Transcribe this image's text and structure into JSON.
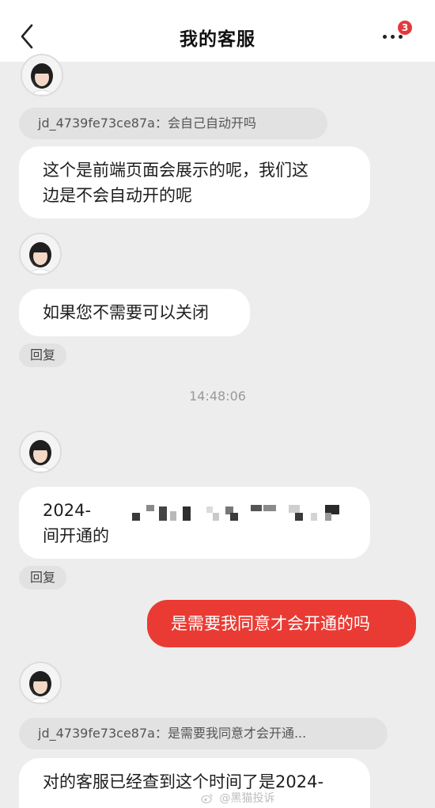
{
  "header": {
    "title": "我的客服",
    "badge_count": "3"
  },
  "messages": {
    "quote_1": "jd_4739fe73ce87a：会自己自动开吗",
    "reply_1": "这个是前端页面会展示的呢，我们这边是不会自动开的呢",
    "reply_1_line1": "这个是前端页面会展示的呢，我们这",
    "reply_1_line2": "边是不会自动开的呢",
    "reply_2": "如果您不需要可以关闭",
    "reply_label": "回复",
    "timestamp": "14:48:06",
    "reply_3_line1": "2024-",
    "reply_3_line2": "间开通的",
    "user_message": "是需要我同意才会开通的吗",
    "quote_2": "jd_4739fe73ce87a：是需要我同意才会开通...",
    "reply_4": "对的客服已经查到这个时间了是2024-"
  },
  "watermark": "@黑猫投诉",
  "colors": {
    "accent": "#e93b34",
    "badge": "#e4393c",
    "background": "#ededed",
    "bubble": "#ffffff"
  }
}
